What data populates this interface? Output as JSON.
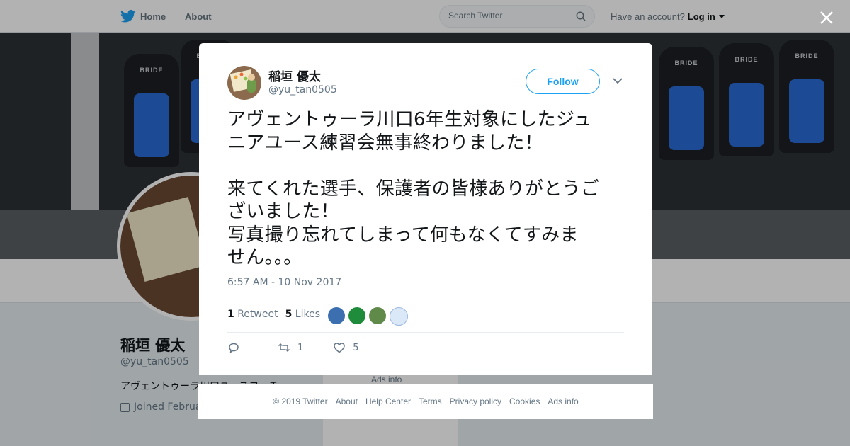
{
  "nav": {
    "home_label": "Home",
    "about_label": "About",
    "search_placeholder": "Search Twitter",
    "have_account": "Have an account?",
    "login_label": "Log in"
  },
  "banner": {
    "seat_brand": "BRIDE"
  },
  "background_profile": {
    "name": "稲垣 優太",
    "handle": "@yu_tan0505",
    "bio": "アヴェントゥーラ川口ユースコーチ",
    "joined": "Joined Februa",
    "ads_info": "Ads info"
  },
  "tweet": {
    "author_name": "稲垣 優太",
    "author_handle": "@yu_tan0505",
    "follow_label": "Follow",
    "text": "アヴェントゥーラ川口6年生対象にしたジュ\nニアユース練習会無事終わりました！\n\n来てくれた選手、保護者の皆様ありがとうご\nざいました！\n写真撮り忘れてしまって何もなくてすみま\nせん。。。",
    "timestamp": "6:57 AM - 10 Nov 2017",
    "retweets_count": "1",
    "retweets_label": "Retweet",
    "likes_count": "5",
    "likes_label": "Likes",
    "retweet_action_count": "1",
    "like_action_count": "5"
  },
  "likers": [
    {
      "name": "liker-avatar-1",
      "color": "#3b6fb0"
    },
    {
      "name": "liker-avatar-2",
      "color": "#1e8c3a"
    },
    {
      "name": "liker-avatar-3",
      "color": "#5f8a4a"
    },
    {
      "name": "liker-avatar-4",
      "color": "#dbe8f7"
    }
  ],
  "footer": {
    "copyright": "© 2019 Twitter",
    "about": "About",
    "help": "Help Center",
    "terms": "Terms",
    "privacy": "Privacy policy",
    "cookies": "Cookies",
    "ads_info": "Ads info"
  },
  "colors": {
    "twitter_blue": "#1da1f2",
    "text_dark": "#14171a",
    "text_muted": "#657786"
  },
  "icons": [
    "twitter-bird-icon",
    "search-icon",
    "close-icon",
    "chevron-down-icon",
    "reply-icon",
    "retweet-icon",
    "like-icon",
    "calendar-icon"
  ]
}
